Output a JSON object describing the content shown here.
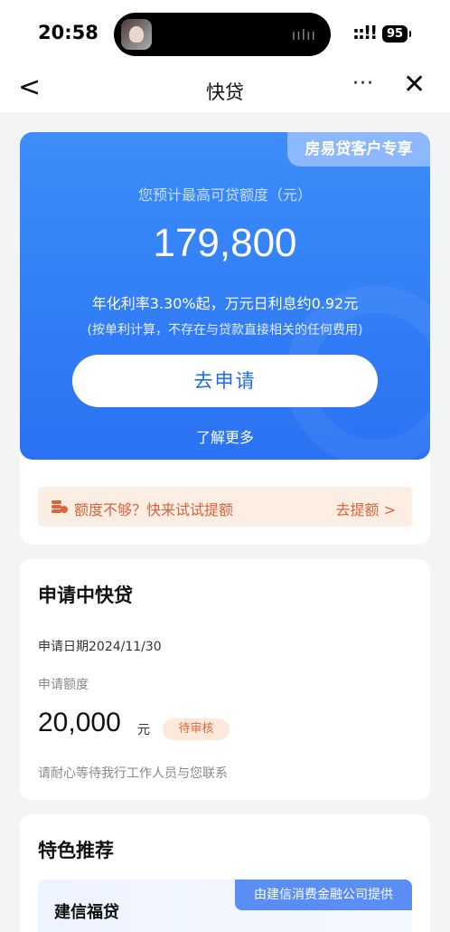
{
  "status_bar": {
    "time": "20:58",
    "signal": "::!!",
    "battery": "95"
  },
  "nav": {
    "back": "<",
    "title": "快贷",
    "more": "···",
    "close": "✕"
  },
  "hero": {
    "tag": "房易贷客户专享",
    "subtitle": "您预计最高可贷额度（元）",
    "amount": "179,800",
    "rate": "年化利率3.30%起，万元日利息约0.92元",
    "note": "(按单利计算，不存在与贷款直接相关的任何费用)",
    "apply_button": "去申请",
    "learn_more": "了解更多"
  },
  "quota_banner": {
    "icon": "coins-icon",
    "text": "额度不够？快来试试提额",
    "link": "去提额 >"
  },
  "applying": {
    "title": "申请中快贷",
    "date": "申请日期2024/11/30",
    "amount_label": "申请额度",
    "amount": "20,000",
    "unit": "元",
    "status": "待审核",
    "hint": "请耐心等待我行工作人员与您联系"
  },
  "recommend": {
    "title": "特色推荐",
    "item_name": "建信福贷",
    "item_badge": "由建信消费金融公司提供"
  },
  "colors": {
    "primary_blue": "#2a72f3",
    "warning_orange": "#d9633a"
  }
}
